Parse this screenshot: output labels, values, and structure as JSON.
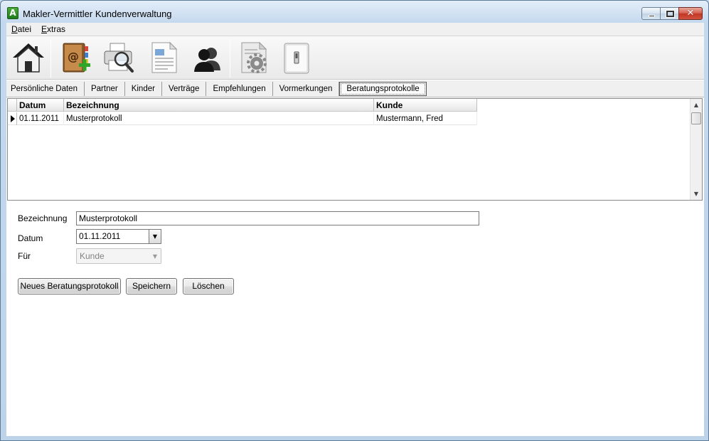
{
  "window": {
    "app_icon_letter": "A",
    "title": "Makler-Vermittler Kundenverwaltung",
    "close_glyph": "✕"
  },
  "menu": [
    {
      "accel": "D",
      "rest": "atei"
    },
    {
      "accel": "E",
      "rest": "xtras"
    }
  ],
  "toolbar": {
    "buttons": [
      {
        "name": "home-icon"
      },
      {
        "name": "address-book-add-icon"
      },
      {
        "name": "print-preview-icon"
      },
      {
        "name": "document-icon"
      },
      {
        "name": "contacts-icon"
      },
      {
        "name": "settings-document-icon"
      },
      {
        "name": "switch-icon"
      }
    ]
  },
  "tabs": [
    "Persönliche Daten",
    "Partner",
    "Kinder",
    "Verträge",
    "Empfehlungen",
    "Vormerkungen",
    "Beratungsprotokolle"
  ],
  "active_tab": "Beratungsprotokolle",
  "grid": {
    "columns": [
      "Datum",
      "Bezeichnung",
      "Kunde"
    ],
    "rows": [
      {
        "datum": "01.11.2011",
        "bezeichnung": "Musterprotokoll",
        "kunde": "Mustermann, Fred"
      }
    ],
    "scroll_up": "▲",
    "scroll_down": "▼"
  },
  "form": {
    "bezeichnung_label": "Bezeichnung",
    "bezeichnung_value": "Musterprotokoll",
    "datum_label": "Datum",
    "datum_value": "01.11.2011",
    "datum_dropdown": "▼",
    "fuer_label": "Für",
    "fuer_value": "Kunde",
    "fuer_arrow": "▼"
  },
  "buttons": {
    "new_label": "Neues Beratungsprotokoll",
    "save_label": "Speichern",
    "delete_label": "Löschen"
  },
  "colors": {
    "window_frame": "#c5d9ee",
    "close_button": "#c13725",
    "app_icon": "#2e8f27"
  }
}
